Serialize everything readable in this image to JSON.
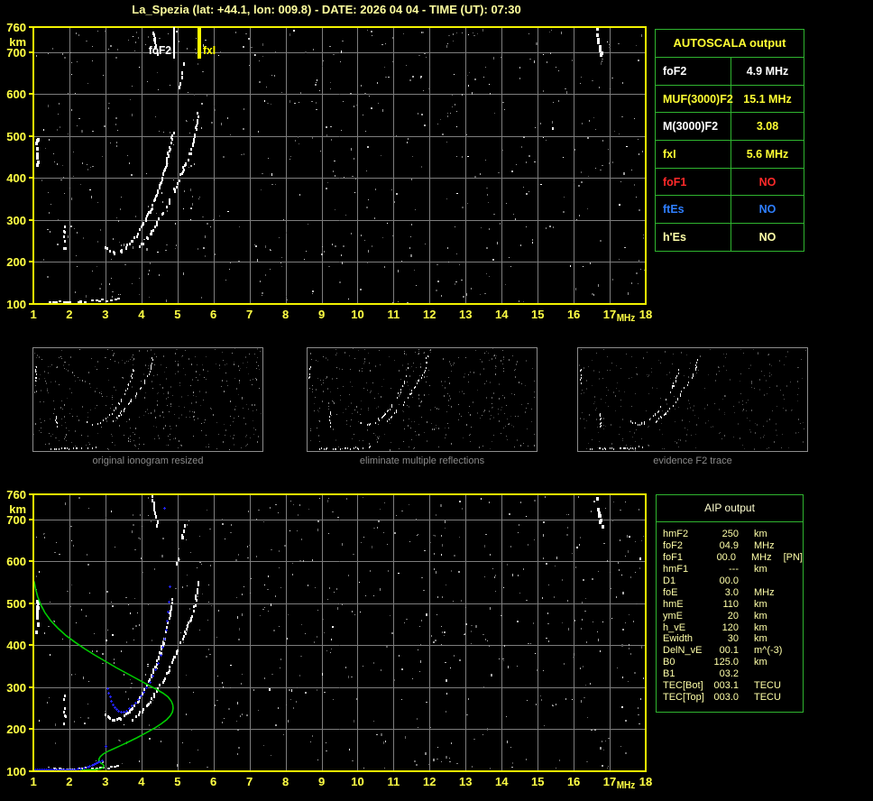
{
  "title": "La_Spezia (lat: +44.1, lon: 009.8) - DATE: 2026 04 04 - TIME (UT): 07:30",
  "colors": {
    "background": "#000000",
    "title_text": "#ffff9e",
    "plot_border": "#f2f200",
    "axis_text": "#ffff44",
    "grid": "#7d7d7d",
    "table_border": "#2fb42f",
    "white": "#ffffff",
    "yellow": "#ffff33",
    "pale_yellow": "#ffffa8",
    "red": "#ff2a2a",
    "blue": "#2f7fff",
    "profile_green": "#00cc00",
    "profile_blue": "#2424ff",
    "thumb_border": "#8c8c8c",
    "thumb_label": "#8a8a8a",
    "noise_seed": 1337
  },
  "autoscala_table": {
    "title": "AUTOSCALA output",
    "rows": [
      {
        "label": "foF2",
        "value": "4.9 MHz",
        "label_color": "#ffffff",
        "value_color": "#ffffff"
      },
      {
        "label": "MUF(3000)F2",
        "value": "15.1 MHz",
        "label_color": "#ffff33",
        "value_color": "#ffff33"
      },
      {
        "label": "M(3000)F2",
        "value": "3.08",
        "label_color": "#ffffff",
        "value_color": "#ffff33"
      },
      {
        "label": "fxI",
        "value": "5.6 MHz",
        "label_color": "#ffff33",
        "value_color": "#ffff33"
      },
      {
        "label": "foF1",
        "value": "NO",
        "label_color": "#ff2a2a",
        "value_color": "#ff2a2a"
      },
      {
        "label": "ftEs",
        "value": "NO",
        "label_color": "#2f7fff",
        "value_color": "#2f7fff"
      },
      {
        "label": "h'Es",
        "value": "NO",
        "label_color": "#ffffa8",
        "value_color": "#ffffa8"
      }
    ]
  },
  "aip_table": {
    "title": "AIP output",
    "rows": [
      {
        "label": "hmF2",
        "value": "250",
        "unit": "km",
        "extra": ""
      },
      {
        "label": "foF2",
        "value": "04.9",
        "unit": "MHz",
        "extra": ""
      },
      {
        "label": "foF1",
        "value": "00.0",
        "unit": "MHz",
        "extra": "[PN]"
      },
      {
        "label": "hmF1",
        "value": "---",
        "unit": "km",
        "extra": ""
      },
      {
        "label": "D1",
        "value": "00.0",
        "unit": "",
        "extra": ""
      },
      {
        "label": "foE",
        "value": "3.0",
        "unit": "MHz",
        "extra": ""
      },
      {
        "label": "hmE",
        "value": "110",
        "unit": "km",
        "extra": ""
      },
      {
        "label": "ymE",
        "value": "20",
        "unit": "km",
        "extra": ""
      },
      {
        "label": "h_vE",
        "value": "120",
        "unit": "km",
        "extra": ""
      },
      {
        "label": "Ewidth",
        "value": "30",
        "unit": "km",
        "extra": ""
      },
      {
        "label": "DelN_vE",
        "value": "00.1",
        "unit": "m^(-3)",
        "extra": ""
      },
      {
        "label": "B0",
        "value": "125.0",
        "unit": "km",
        "extra": ""
      },
      {
        "label": "B1",
        "value": "03.2",
        "unit": "",
        "extra": ""
      },
      {
        "label": "TEC[Bot]",
        "value": "003.1",
        "unit": "TECU",
        "extra": ""
      },
      {
        "label": "TEC[Top]",
        "value": "003.0",
        "unit": "TECU",
        "extra": ""
      }
    ]
  },
  "thumbnails": [
    {
      "label": "original ionogram resized",
      "noise_count": 430,
      "noise_max_bright": 150,
      "seed": 11
    },
    {
      "label": "eliminate multiple reflections",
      "noise_count": 390,
      "noise_max_bright": 140,
      "seed": 22
    },
    {
      "label": "evidence F2 trace",
      "noise_count": 300,
      "noise_max_bright": 95,
      "seed": 33
    }
  ],
  "chart_data": {
    "type": "scatter",
    "title": "ionogram virtual height vs frequency",
    "xlabel": "MHz",
    "ylabel": "km",
    "x_range": [
      1,
      18
    ],
    "y_range": [
      100,
      760
    ],
    "x_ticks": [
      "1",
      "2",
      "3",
      "4",
      "5",
      "6",
      "7",
      "8",
      "9",
      "10",
      "11",
      "12",
      "13",
      "14",
      "15",
      "16",
      "17",
      "18"
    ],
    "x_unit_label": "MHz",
    "y_ticks": [
      "760",
      "700",
      "600",
      "500",
      "400",
      "300",
      "200",
      "100"
    ],
    "y_tick_values": [
      760,
      700,
      600,
      500,
      400,
      300,
      200,
      100
    ],
    "y_unit_label": "km",
    "grid": true,
    "markers": {
      "fof2_label": "foF2",
      "fof2_mhz": 4.9,
      "fxi_label": "fxI",
      "fxi_mhz": 5.6
    },
    "echo_traces": [
      {
        "name": "E-layer",
        "w": 3,
        "h": 2,
        "step": 3,
        "p": 0.62,
        "pts": [
          [
            1.45,
            106
          ],
          [
            1.7,
            107
          ],
          [
            2.0,
            107
          ],
          [
            2.3,
            108
          ],
          [
            2.6,
            108
          ],
          [
            2.9,
            110
          ],
          [
            3.15,
            112
          ],
          [
            3.4,
            116
          ]
        ]
      },
      {
        "name": "F2-ordinary",
        "w": 2,
        "h": 3,
        "step": 2,
        "p": 0.72,
        "pts": [
          [
            3.0,
            238
          ],
          [
            3.12,
            228
          ],
          [
            3.25,
            224
          ],
          [
            3.4,
            228
          ],
          [
            3.55,
            238
          ],
          [
            3.72,
            252
          ],
          [
            3.9,
            272
          ],
          [
            4.05,
            295
          ],
          [
            4.2,
            320
          ],
          [
            4.35,
            350
          ],
          [
            4.5,
            385
          ],
          [
            4.62,
            420
          ],
          [
            4.72,
            455
          ],
          [
            4.8,
            490
          ],
          [
            4.85,
            510
          ]
        ]
      },
      {
        "name": "F2-extraordinary",
        "w": 2,
        "h": 3,
        "step": 2,
        "p": 0.6,
        "pts": [
          [
            3.85,
            235
          ],
          [
            4.0,
            245
          ],
          [
            4.15,
            260
          ],
          [
            4.3,
            280
          ],
          [
            4.5,
            308
          ],
          [
            4.7,
            340
          ],
          [
            4.9,
            375
          ],
          [
            5.08,
            410
          ],
          [
            5.22,
            440
          ],
          [
            5.35,
            468
          ],
          [
            5.45,
            495
          ],
          [
            5.52,
            530
          ],
          [
            5.55,
            560
          ]
        ]
      },
      {
        "name": "left-blob",
        "w": 3,
        "h": 4,
        "step": 3,
        "p": 0.6,
        "pts": [
          [
            1.08,
            435
          ],
          [
            1.08,
            455
          ],
          [
            1.08,
            475
          ],
          [
            1.08,
            495
          ],
          [
            1.08,
            510
          ]
        ]
      },
      {
        "name": "dashes-1.85MHz",
        "w": 2,
        "h": 3,
        "step": 3,
        "p": 0.45,
        "pts": [
          [
            1.85,
            215
          ],
          [
            1.85,
            235
          ],
          [
            1.85,
            255
          ],
          [
            1.85,
            275
          ],
          [
            1.85,
            288
          ]
        ]
      },
      {
        "name": "multiple-echo-a",
        "w": 2,
        "h": 4,
        "step": 3,
        "p": 0.6,
        "pts": [
          [
            4.28,
            760
          ],
          [
            4.33,
            735
          ],
          [
            4.38,
            712
          ],
          [
            4.42,
            692
          ]
        ]
      },
      {
        "name": "multiple-echo-b",
        "w": 2,
        "h": 4,
        "step": 3,
        "p": 0.55,
        "pts": [
          [
            4.98,
            600
          ],
          [
            5.05,
            630
          ],
          [
            5.12,
            660
          ],
          [
            5.2,
            690
          ]
        ]
      },
      {
        "name": "blob-16.7MHz",
        "w": 3,
        "h": 4,
        "step": 3,
        "p": 0.7,
        "pts": [
          [
            16.62,
            760
          ],
          [
            16.66,
            735
          ],
          [
            16.7,
            710
          ],
          [
            16.74,
            688
          ]
        ]
      }
    ],
    "profile_green_pts": [
      [
        1.02,
        553
      ],
      [
        1.06,
        535
      ],
      [
        1.12,
        516
      ],
      [
        1.2,
        498
      ],
      [
        1.32,
        478
      ],
      [
        1.48,
        459
      ],
      [
        1.68,
        441
      ],
      [
        1.9,
        424
      ],
      [
        2.15,
        408
      ],
      [
        2.42,
        392
      ],
      [
        2.7,
        377
      ],
      [
        3.0,
        362
      ],
      [
        3.3,
        347
      ],
      [
        3.6,
        333
      ],
      [
        3.9,
        319
      ],
      [
        4.18,
        306
      ],
      [
        4.42,
        295
      ],
      [
        4.6,
        286
      ],
      [
        4.74,
        277
      ],
      [
        4.83,
        267
      ],
      [
        4.87,
        258
      ],
      [
        4.88,
        250
      ],
      [
        4.86,
        241
      ],
      [
        4.8,
        232
      ],
      [
        4.7,
        223
      ],
      [
        4.55,
        213
      ],
      [
        4.35,
        202
      ],
      [
        4.12,
        191
      ],
      [
        3.88,
        180
      ],
      [
        3.64,
        170
      ],
      [
        3.42,
        161
      ],
      [
        3.22,
        153
      ],
      [
        3.06,
        147
      ],
      [
        2.94,
        141
      ],
      [
        2.86,
        135
      ],
      [
        2.82,
        129
      ],
      [
        2.82,
        124
      ],
      [
        2.86,
        120
      ],
      [
        2.92,
        117
      ],
      [
        2.96,
        113
      ],
      [
        2.94,
        109
      ],
      [
        2.86,
        106
      ],
      [
        2.72,
        104
      ],
      [
        2.52,
        103
      ],
      [
        2.3,
        102
      ]
    ],
    "profile_blue_pts": [
      [
        1.0,
        104
      ],
      [
        1.05,
        104
      ],
      [
        1.1,
        104
      ],
      [
        1.15,
        104
      ],
      [
        1.2,
        104
      ],
      [
        1.25,
        104
      ],
      [
        1.3,
        104
      ],
      [
        1.35,
        104
      ],
      [
        1.4,
        104
      ],
      [
        1.45,
        104
      ],
      [
        1.5,
        104
      ],
      [
        1.55,
        104
      ],
      [
        1.6,
        104
      ],
      [
        1.65,
        104
      ],
      [
        1.7,
        104
      ],
      [
        1.75,
        104
      ],
      [
        1.8,
        104
      ],
      [
        1.85,
        104
      ],
      [
        1.9,
        104
      ],
      [
        1.95,
        104
      ],
      [
        2.0,
        105
      ],
      [
        2.05,
        105
      ],
      [
        2.1,
        105
      ],
      [
        2.16,
        105
      ],
      [
        2.22,
        106
      ],
      [
        2.3,
        107
      ],
      [
        2.4,
        109
      ],
      [
        2.5,
        111
      ],
      [
        2.56,
        113
      ],
      [
        2.62,
        115
      ],
      [
        2.68,
        117
      ],
      [
        2.73,
        119
      ],
      [
        2.78,
        121
      ],
      [
        2.83,
        123
      ],
      [
        2.9,
        126
      ],
      [
        3.0,
        161
      ],
      [
        3.05,
        298
      ],
      [
        3.08,
        288
      ],
      [
        3.12,
        278
      ],
      [
        3.16,
        268
      ],
      [
        3.2,
        260
      ],
      [
        3.25,
        253
      ],
      [
        3.3,
        248
      ],
      [
        3.36,
        244
      ],
      [
        3.42,
        242
      ],
      [
        3.5,
        242
      ],
      [
        3.58,
        245
      ],
      [
        3.66,
        250
      ],
      [
        3.74,
        256
      ],
      [
        3.82,
        263
      ],
      [
        3.9,
        271
      ],
      [
        3.98,
        280
      ],
      [
        4.06,
        290
      ],
      [
        4.14,
        301
      ],
      [
        4.22,
        313
      ],
      [
        4.3,
        327
      ],
      [
        4.38,
        342
      ],
      [
        4.46,
        359
      ],
      [
        4.52,
        377
      ],
      [
        4.58,
        396
      ],
      [
        4.63,
        416
      ],
      [
        4.67,
        437
      ],
      [
        4.7,
        458
      ],
      [
        4.73,
        480
      ],
      [
        4.75,
        505
      ],
      [
        4.77,
        540
      ],
      [
        4.63,
        728
      ]
    ]
  }
}
